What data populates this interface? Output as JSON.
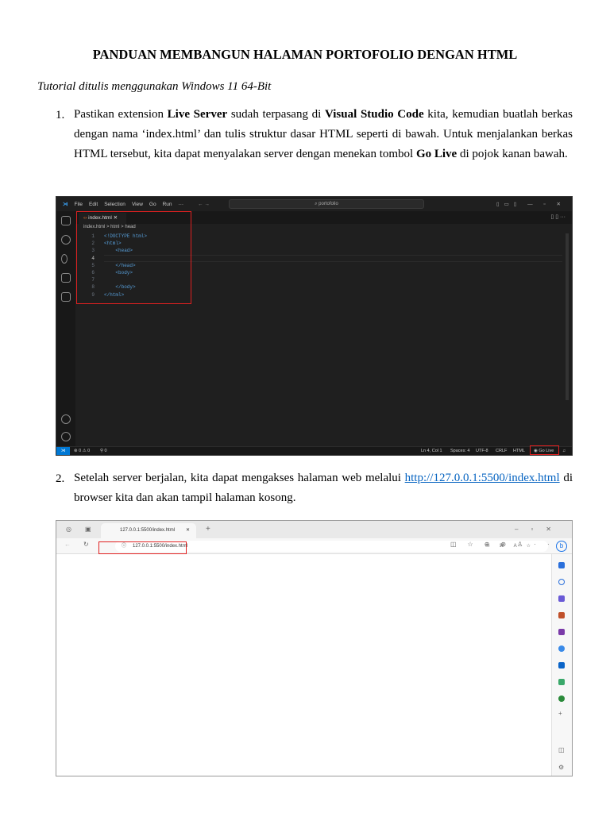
{
  "doc": {
    "title": "PANDUAN MEMBANGUN HALAMAN PORTOFOLIO DENGAN HTML",
    "subtitle": "Tutorial ditulis menggunakan Windows 11 64-Bit",
    "step1": {
      "num": "1.",
      "t1": "Pastikan extension ",
      "b1": "Live Server",
      "t2": " sudah terpasang di ",
      "b2": "Visual Studio Code",
      "t3": " kita, kemudian buatlah berkas dengan nama ‘index.html’ dan tulis struktur dasar HTML seperti di bawah. Untuk menjalankan berkas HTML tersebut, kita dapat menyalakan server dengan menekan tombol ",
      "b3": "Go Live",
      "t4": " di pojok kanan bawah."
    },
    "step2": {
      "num": "2.",
      "t1": "Setelah server berjalan, kita dapat mengakses halaman web melalui ",
      "link": "http://127.0.0.1:5500/index.html",
      "t2": " di browser kita dan akan tampil halaman kosong."
    }
  },
  "vscode": {
    "menu": [
      "File",
      "Edit",
      "Selection",
      "View",
      "Go",
      "Run",
      "···"
    ],
    "search": "⌕ portofolio",
    "tab": "index.html",
    "breadcrumb": "index.html > html > head",
    "code": [
      {
        "n": "1",
        "text": "<!DOCTYPE html>"
      },
      {
        "n": "2",
        "text": "<html>"
      },
      {
        "n": "3",
        "text": "    <head>"
      },
      {
        "n": "4",
        "text": ""
      },
      {
        "n": "5",
        "text": "    </head>"
      },
      {
        "n": "6",
        "text": "    <body>"
      },
      {
        "n": "7",
        "text": ""
      },
      {
        "n": "8",
        "text": "    </body>"
      },
      {
        "n": "9",
        "text": "</html>"
      }
    ],
    "status": {
      "problems": "⊗ 0 ⚠ 0",
      "ports": "⚲ 0",
      "position": "Ln 4, Col 1",
      "spaces": "Spaces: 4",
      "encoding": "UTF-8",
      "eol": "CRLF",
      "lang": "HTML",
      "golive": "Go Live"
    }
  },
  "browser": {
    "tab": "127.0.0.1:5500/index.html",
    "url": "127.0.0.1:5500/index.html"
  }
}
